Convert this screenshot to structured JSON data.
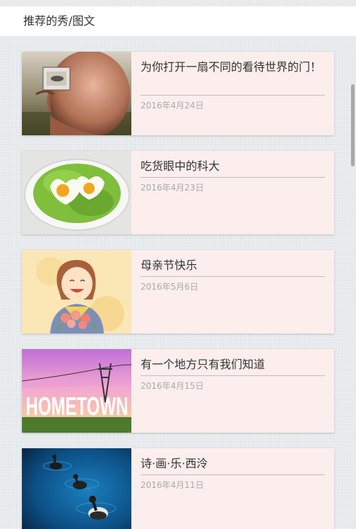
{
  "header": {
    "title": "推荐的秀/图文"
  },
  "articles": [
    {
      "title": "为你打开一扇不同的看待世界的门！",
      "date": "2016年4月24日",
      "thumbnail": "bald-head-mirror"
    },
    {
      "title": "吃货眼中的科大",
      "date": "2016年4月23日",
      "thumbnail": "heart-eggs-lettuce"
    },
    {
      "title": "母亲节快乐",
      "date": "2016年5月6日",
      "thumbnail": "mother-with-flowers"
    },
    {
      "title": "有一个地方只有我们知道",
      "date": "2016年4月15日",
      "thumbnail": "hometown-sunset",
      "thumbnail_text": "HOMETOWN"
    },
    {
      "title": "诗·画·乐·西泠",
      "date": "2016年4月11日",
      "thumbnail": "ducks-on-water"
    }
  ]
}
